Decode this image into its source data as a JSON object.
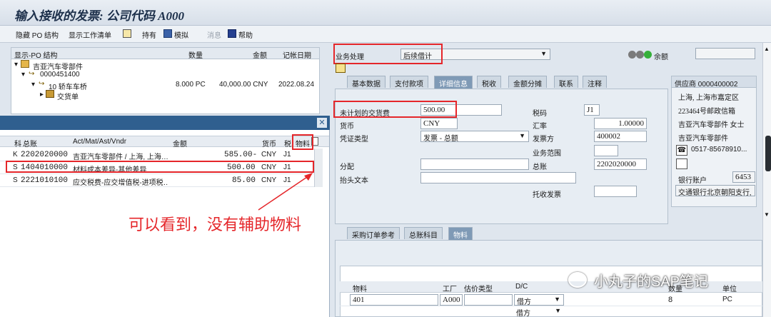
{
  "window": {
    "title": "输入接收的发票: 公司代码 A000"
  },
  "toolbar": {
    "hide_po": "隐藏 PO 结构",
    "show_worklist": "显示工作清单",
    "hold": "持有",
    "simulate": "模拟",
    "messages": "消息",
    "help": "帮助"
  },
  "po_tree": {
    "headers": {
      "structure": "显示-PO 结构",
      "qty": "数量",
      "amount": "金额",
      "date": "记帐日期"
    },
    "rows": [
      {
        "label": "吉亚汽车零部件"
      },
      {
        "label": "0000451400"
      },
      {
        "label": "10 轿车车桥",
        "qty": "8.000 PC",
        "amount": "40,000.00 CNY",
        "date": "2022.08.24"
      },
      {
        "label": "交货单"
      }
    ]
  },
  "popup": {
    "headers": {
      "flag": "科",
      "gl": "总账",
      "desc": "Act/Mat/Ast/Vndr",
      "amount": "金额",
      "currency": "货币",
      "tax": "税",
      "material": "物料"
    },
    "rows": [
      {
        "flag": "K",
        "gl": "2202020000",
        "desc": "吉亚汽车零部件 / 上海, 上海…",
        "amount": "585.00-",
        "currency": "CNY",
        "tax": "J1"
      },
      {
        "flag": "S",
        "gl": "1404010000",
        "desc": "材料成本差异-其他差异",
        "amount": "500.00",
        "currency": "CNY",
        "tax": "J1"
      },
      {
        "flag": "S",
        "gl": "2221010100",
        "desc": "应交税费-应交增值税-进项税…",
        "amount": "85.00",
        "currency": "CNY",
        "tax": "J1"
      }
    ]
  },
  "annotation": "可以看到，没有辅助物料",
  "form": {
    "transaction_label": "业务处理",
    "transaction_value": "后续借计",
    "balance_label": "余额",
    "tabs": [
      "基本数据",
      "支付款项",
      "详细信息",
      "税收",
      "金额分摊",
      "联系",
      "注释"
    ],
    "active_tab": "详细信息",
    "unplanned_label": "未计划的交货费",
    "unplanned_value": "500.00",
    "currency_label": "货币",
    "currency_value": "CNY",
    "doctype_label": "凭证类型",
    "doctype_value": "发票 - 总额",
    "taxcode_label": "税码",
    "taxcode_value": "J1",
    "rate_label": "汇率",
    "rate_value": "1.00000",
    "invoicing_party_label": "发票方",
    "invoicing_party_value": "400002",
    "business_area_label": "业务范围",
    "assignment_label": "分配",
    "gl_label": "总账",
    "gl_value": "2202020000",
    "header_text_label": "抬头文本",
    "collection_label": "托收发票"
  },
  "vendor": {
    "title": "供应商 0000400002",
    "city": "上海, 上海市嘉定区",
    "address": "223464号邮政信箱",
    "name1": "吉亚汽车零部件 女士",
    "name2": "吉亚汽车零部件",
    "phone": "0517-85678910...",
    "bank_label": "银行账户",
    "bank_value": "6453",
    "bank_name": "交通银行北京朝阳支行,"
  },
  "bottom": {
    "tabs": [
      "采购订单参考",
      "总账科目",
      "物料"
    ],
    "active_tab": "物料",
    "headers": {
      "material": "物料",
      "plant": "工厂",
      "valuation": "估价类型",
      "dc": "D/C",
      "qty": "数量",
      "unit": "单位"
    },
    "rows": [
      {
        "material": "401",
        "plant": "A000",
        "dc": "借方",
        "qty": "8",
        "unit": "PC"
      },
      {
        "dc": "借方"
      }
    ]
  },
  "watermark": "小丸子的SAP笔记",
  "colors": {
    "accent_red": "#e5262a",
    "tab_active": "#7f9ab6",
    "popup_title": "#2f5f8f"
  }
}
